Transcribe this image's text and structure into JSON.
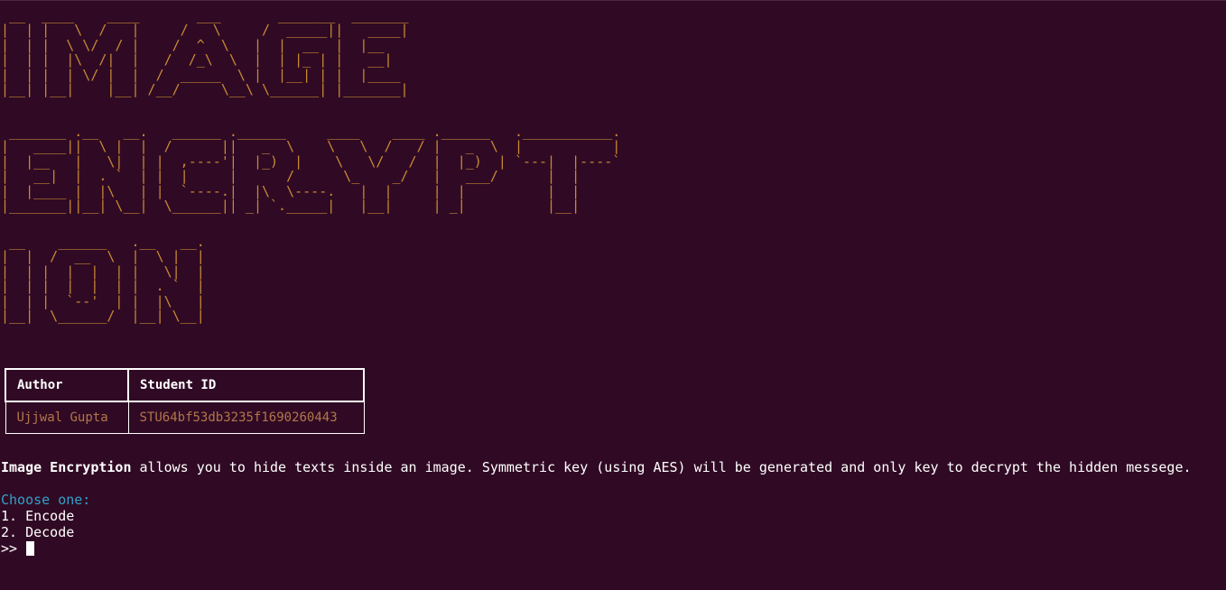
{
  "banner": {
    "word_1": "IMAGE",
    "word_2": "ENCRYPT",
    "word_3": "ION",
    "art_1": " __  ____    ____       ___       _______  _______ \n|  | |   \\  /   |     /   \\     /  _____||   ____|\n|  | |  \\ \\/  / |    /  ^  \\   |  |  __  |  |__   \n|  | |  |\\  /|  |   /  /_\\  \\  |  | |_ | |   __|  \n|  | |  | \\/ |  |  /  _____  \\ |  |__| | |  |____ \n|__| |__|    |__| /__/     \\__\\ \\______| |_______|",
    "art_2": " _______ .__   __.   ______ .______     ____    ____ .______   .___________.\n|   ____||  \\ |  |  /      ||   _  \\    \\   \\  /   / |   _  \\  |           |\n|  |__   |   \\|  | |  ,----'|  |_)  |    \\   \\/   /  |  |_)  | `---|  |----`\n|   __|  |  . `  | |  |     |      /      \\_    _/   |   ___/      |  |     \n|  |____ |  |\\   | |  `----.|  |\\  \\----.   |  |     |  |          |  |     \n|_______||__| \\__|  \\______|| _| `._____|   |__|     | _|          |__|     ",
    "art_3": " __    ______   .__   __. \n|  |  /  __  \\  |  \\ |  | \n|  | |  |  |  | |   \\|  | \n|  | |  |  |  | |  . `  | \n|  | |  `--'  | |  |\\   | \n|__|  \\______/  |__| \\__| "
  },
  "table": {
    "headers": {
      "author": "Author",
      "student_id": "Student ID"
    },
    "rows": [
      {
        "author": "Ujjwal Gupta",
        "student_id": "STU64bf53db3235f1690260443"
      }
    ]
  },
  "description": {
    "bold": "Image Encryption",
    "rest": " allows you to hide texts inside an image. Symmetric key (using AES) will be generated and only key to decrypt the hidden messege."
  },
  "menu": {
    "prompt_title": "Choose one:",
    "options": [
      "1. Encode",
      "2. Decode"
    ],
    "input_prompt": ">> "
  },
  "colors": {
    "background": "#300a24",
    "banner": "#c88a35",
    "table_cell": "#b3764a",
    "choose_prompt": "#34a0c8",
    "text": "#ffffff"
  }
}
